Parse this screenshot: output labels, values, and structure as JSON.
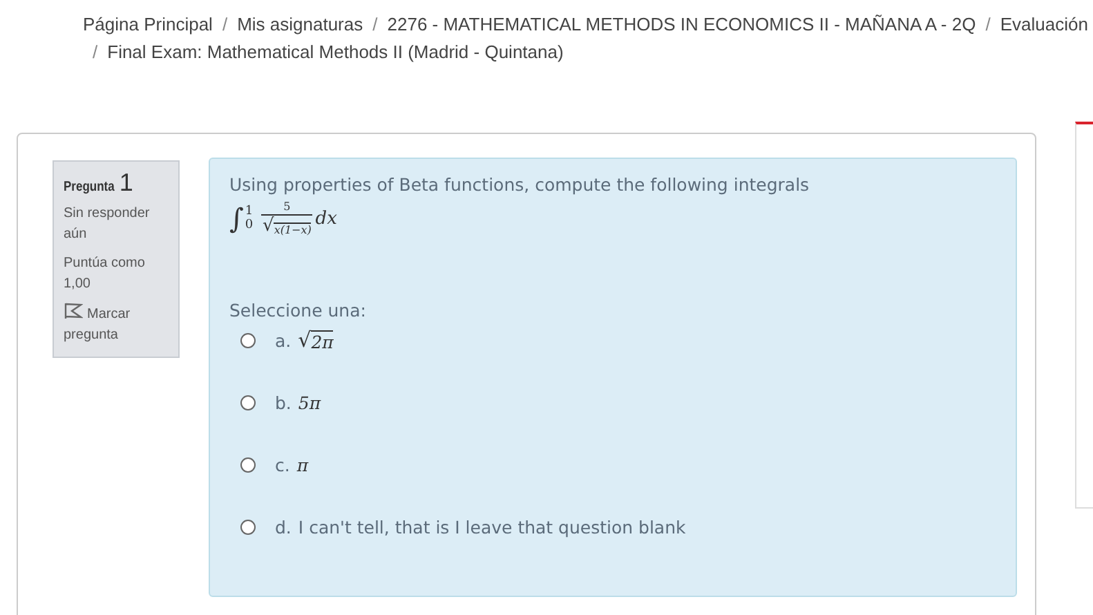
{
  "breadcrumb": {
    "separator": "/",
    "items": [
      "Página Principal",
      "Mis asignaturas",
      "2276 - MATHEMATICAL METHODS IN ECONOMICS II - MAÑANA A - 2Q",
      "Evaluación",
      "Final Exam: Mathematical Methods II (Madrid - Quintana)"
    ]
  },
  "question_info": {
    "label": "Pregunta",
    "number": "1",
    "status": "Sin responder aún",
    "grade": "Puntúa como 1,00",
    "flag": "Marcar pregunta"
  },
  "question": {
    "text": "Using properties of Beta functions, compute the following integrals",
    "formula": {
      "symbol": "∫",
      "upper": "1",
      "lower": "0",
      "numerator": "5",
      "radical": "√",
      "radicand": "x(1−x)",
      "differential": "dx"
    },
    "prompt": "Seleccione una:",
    "options": [
      {
        "letter": "a.",
        "kind": "sqrt",
        "radical": "√",
        "value": "2π",
        "selected": false
      },
      {
        "letter": "b.",
        "kind": "math",
        "value": "5π",
        "selected": false
      },
      {
        "letter": "c.",
        "kind": "math",
        "value": "π",
        "selected": false
      },
      {
        "letter": "d.",
        "kind": "text",
        "value": "I can't tell, that is I leave that question blank",
        "selected": false
      }
    ]
  }
}
